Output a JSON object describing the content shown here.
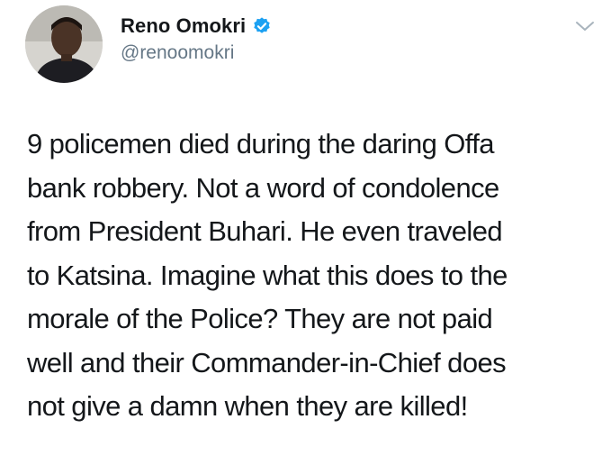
{
  "author": {
    "display_name": "Reno Omokri",
    "handle": "@renoomokri",
    "verified": true
  },
  "icons": {
    "verified": "verified-badge-icon",
    "menu": "chevron-down-icon"
  },
  "colors": {
    "text": "#14171a",
    "secondary": "#657786",
    "verified": "#1da1f2"
  },
  "tweet": {
    "lines": [
      "9 policemen died during the daring Offa",
      "bank robbery. Not a word of condolence",
      "from President Buhari. He even traveled",
      "to Katsina. Imagine what this does to the",
      "morale of the Police? They are not paid",
      "well and their Commander-in-Chief does",
      "not give a damn when they are killed!"
    ]
  }
}
